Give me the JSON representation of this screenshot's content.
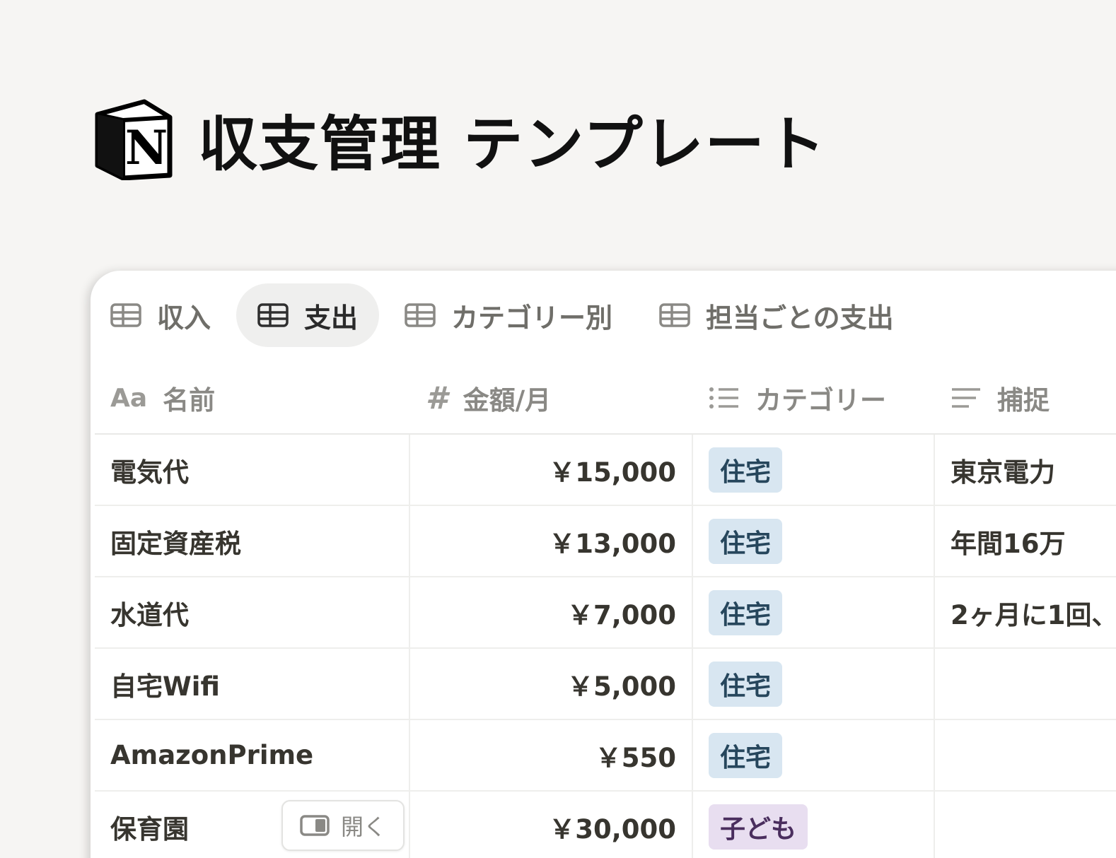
{
  "page": {
    "title": "収支管理 テンプレート",
    "logo_icon": "notion-logo-icon"
  },
  "tabs": [
    {
      "label": "収入",
      "icon": "table-icon",
      "active": false
    },
    {
      "label": "支出",
      "icon": "table-icon",
      "active": true
    },
    {
      "label": "カテゴリー別",
      "icon": "table-icon",
      "active": false
    },
    {
      "label": "担当ごとの支出",
      "icon": "table-icon",
      "active": false
    }
  ],
  "columns": {
    "name": {
      "label": "名前",
      "icon": "Aa"
    },
    "amount": {
      "label": "金額/月",
      "icon": "#"
    },
    "category": {
      "label": "カテゴリー",
      "icon": "list-icon"
    },
    "note": {
      "label": "捕捉",
      "icon": "text-icon"
    }
  },
  "rows": [
    {
      "name": "電気代",
      "amount": "￥15,000",
      "category": "住宅",
      "note": "東京電力"
    },
    {
      "name": "固定資産税",
      "amount": "￥13,000",
      "category": "住宅",
      "note": "年間16万"
    },
    {
      "name": "水道代",
      "amount": "￥7,000",
      "category": "住宅",
      "note": "2ヶ月に1回、"
    },
    {
      "name": "自宅Wifi",
      "amount": "￥5,000",
      "category": "住宅",
      "note": ""
    },
    {
      "name": "AmazonPrime",
      "amount": "￥550",
      "category": "住宅",
      "note": ""
    },
    {
      "name": "保育園",
      "amount": "￥30,000",
      "category": "子ども",
      "note": ""
    }
  ],
  "open_button": {
    "label": "開く"
  },
  "colors": {
    "tag_housing_bg": "#d8e6f1",
    "tag_housing_text": "#26465c",
    "tag_child_bg": "#e8def0",
    "tag_child_text": "#4a2e5e",
    "background": "#f6f5f3"
  }
}
